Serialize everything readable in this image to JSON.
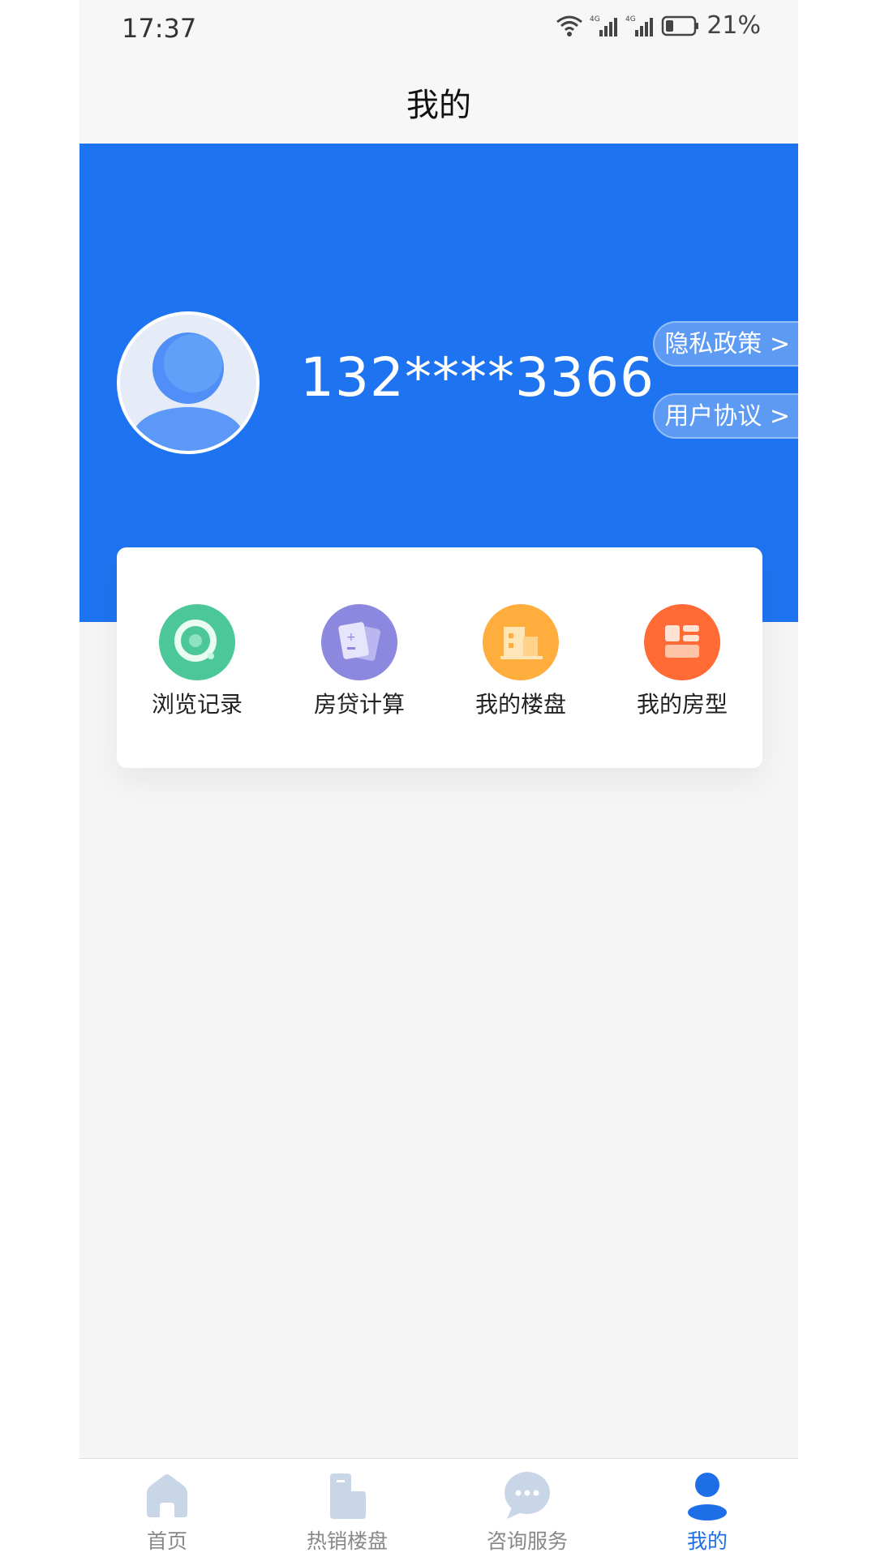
{
  "status_bar": {
    "time": "17:37",
    "battery_percent": "21%",
    "network_1": "4G",
    "network_2": "4G"
  },
  "header": {
    "title": "我的"
  },
  "profile": {
    "phone": "132****3366",
    "avatar_icon": "user-avatar-icon"
  },
  "links": {
    "privacy": "隐私政策 >",
    "agreement": "用户协议 >"
  },
  "features": [
    {
      "label": "浏览记录",
      "icon": "browse-history-icon",
      "color": "#4cc79a"
    },
    {
      "label": "房贷计算",
      "icon": "calculator-icon",
      "color": "#8c88e0"
    },
    {
      "label": "我的楼盘",
      "icon": "building-icon",
      "color": "#ffad3d"
    },
    {
      "label": "我的房型",
      "icon": "floorplan-icon",
      "color": "#ff6a35"
    }
  ],
  "tabs": [
    {
      "label": "首页",
      "icon": "home-icon",
      "active": false
    },
    {
      "label": "热销楼盘",
      "icon": "property-icon",
      "active": false
    },
    {
      "label": "咨询服务",
      "icon": "chat-icon",
      "active": false
    },
    {
      "label": "我的",
      "icon": "user-icon",
      "active": true
    }
  ],
  "colors": {
    "primary": "#1e74f0",
    "tab_active": "#1e6ee8",
    "tab_inactive": "#888888"
  }
}
